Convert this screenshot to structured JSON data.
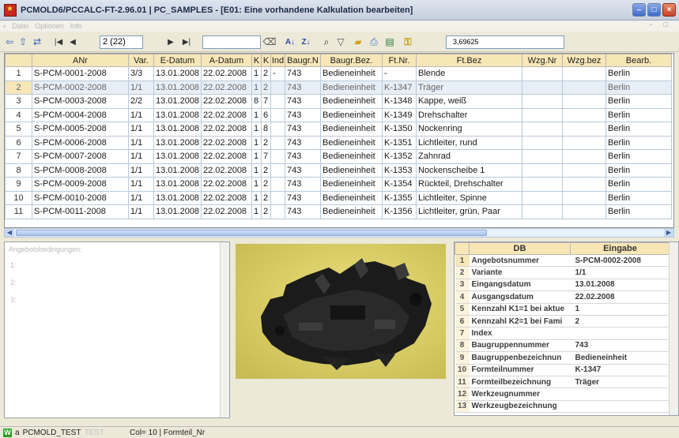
{
  "window": {
    "title": "PCMOLD6/PCCALC-FT-2.96.01  |  PC_SAMPLES - [E01: Eine vorhandene Kalkulation bearbeiten]",
    "minimize": "–",
    "maximize": "□",
    "close": "×"
  },
  "menu": [
    "Datei",
    "Optionen",
    "Info"
  ],
  "mdi_controls": "- □",
  "toolbar": {
    "record_position": "2 (22)",
    "value_field": "3,69625"
  },
  "grid": {
    "columns": [
      "ANr",
      "Var.",
      "E-Datum",
      "A-Datum",
      "K",
      "K",
      "Ind",
      "Baugr.N",
      "Baugr.Bez.",
      "Ft.Nr.",
      "Ft.Bez",
      "Wzg.Nr",
      "Wzg.bez",
      "Bearb."
    ],
    "rows": [
      {
        "n": "1",
        "anr": "S-PCM-0001-2008",
        "var": "3/3",
        "ed": "13.01.2008",
        "ad": "22.02.2008",
        "k1": "1",
        "k2": "2",
        "ind": "-",
        "bgn": "743",
        "bgb": "Bedieneinheit",
        "ftnr": "-",
        "ftbez": "Blende",
        "wnr": "",
        "wbez": "",
        "bearb": "Berlin"
      },
      {
        "n": "2",
        "anr": "S-PCM-0002-2008",
        "var": "1/1",
        "ed": "13.01.2008",
        "ad": "22.02.2008",
        "k1": "1",
        "k2": "2",
        "ind": "",
        "bgn": "743",
        "bgb": "Bedieneinheit",
        "ftnr": "K-1347",
        "ftbez": "Träger",
        "wnr": "",
        "wbez": "",
        "bearb": "Berlin"
      },
      {
        "n": "3",
        "anr": "S-PCM-0003-2008",
        "var": "2/2",
        "ed": "13.01.2008",
        "ad": "22.02.2008",
        "k1": "8",
        "k2": "7",
        "ind": "",
        "bgn": "743",
        "bgb": "Bedieneinheit",
        "ftnr": "K-1348",
        "ftbez": "Kappe, weiß",
        "wnr": "",
        "wbez": "",
        "bearb": "Berlin"
      },
      {
        "n": "4",
        "anr": "S-PCM-0004-2008",
        "var": "1/1",
        "ed": "13.01.2008",
        "ad": "22.02.2008",
        "k1": "1",
        "k2": "6",
        "ind": "",
        "bgn": "743",
        "bgb": "Bedieneinheit",
        "ftnr": "K-1349",
        "ftbez": "Drehschalter",
        "wnr": "",
        "wbez": "",
        "bearb": "Berlin"
      },
      {
        "n": "5",
        "anr": "S-PCM-0005-2008",
        "var": "1/1",
        "ed": "13.01.2008",
        "ad": "22.02.2008",
        "k1": "1",
        "k2": "8",
        "ind": "",
        "bgn": "743",
        "bgb": "Bedieneinheit",
        "ftnr": "K-1350",
        "ftbez": "Nockenring",
        "wnr": "",
        "wbez": "",
        "bearb": "Berlin"
      },
      {
        "n": "6",
        "anr": "S-PCM-0006-2008",
        "var": "1/1",
        "ed": "13.01.2008",
        "ad": "22.02.2008",
        "k1": "1",
        "k2": "2",
        "ind": "",
        "bgn": "743",
        "bgb": "Bedieneinheit",
        "ftnr": "K-1351",
        "ftbez": "Lichtleiter, rund",
        "wnr": "",
        "wbez": "",
        "bearb": "Berlin"
      },
      {
        "n": "7",
        "anr": "S-PCM-0007-2008",
        "var": "1/1",
        "ed": "13.01.2008",
        "ad": "22.02.2008",
        "k1": "1",
        "k2": "7",
        "ind": "",
        "bgn": "743",
        "bgb": "Bedieneinheit",
        "ftnr": "K-1352",
        "ftbez": "Zahnrad",
        "wnr": "",
        "wbez": "",
        "bearb": "Berlin"
      },
      {
        "n": "8",
        "anr": "S-PCM-0008-2008",
        "var": "1/1",
        "ed": "13.01.2008",
        "ad": "22.02.2008",
        "k1": "1",
        "k2": "2",
        "ind": "",
        "bgn": "743",
        "bgb": "Bedieneinheit",
        "ftnr": "K-1353",
        "ftbez": "Nockenscheibe 1",
        "wnr": "",
        "wbez": "",
        "bearb": "Berlin"
      },
      {
        "n": "9",
        "anr": "S-PCM-0009-2008",
        "var": "1/1",
        "ed": "13.01.2008",
        "ad": "22.02.2008",
        "k1": "1",
        "k2": "2",
        "ind": "",
        "bgn": "743",
        "bgb": "Bedieneinheit",
        "ftnr": "K-1354",
        "ftbez": "Rückteil, Drehschalter",
        "wnr": "",
        "wbez": "",
        "bearb": "Berlin"
      },
      {
        "n": "10",
        "anr": "S-PCM-0010-2008",
        "var": "1/1",
        "ed": "13.01.2008",
        "ad": "22.02.2008",
        "k1": "1",
        "k2": "2",
        "ind": "",
        "bgn": "743",
        "bgb": "Bedieneinheit",
        "ftnr": "K-1355",
        "ftbez": "Lichtleiter, Spinne",
        "wnr": "",
        "wbez": "",
        "bearb": "Berlin"
      },
      {
        "n": "11",
        "anr": "S-PCM-0011-2008",
        "var": "1/1",
        "ed": "13.01.2008",
        "ad": "22.02.2008",
        "k1": "1",
        "k2": "2",
        "ind": "",
        "bgn": "743",
        "bgb": "Bedieneinheit",
        "ftnr": "K-1356",
        "ftbez": "Lichtleiter, grün, Paar",
        "wnr": "",
        "wbez": "",
        "bearb": "Berlin"
      }
    ],
    "selected_row": 2
  },
  "notes": {
    "label": "Angebotsbedingungen:",
    "lines": [
      "1:",
      "2:",
      "3:"
    ]
  },
  "db_panel": {
    "headers": [
      "DB",
      "Eingabe"
    ],
    "rows": [
      {
        "n": "1",
        "db": "Angebotsnummer",
        "val": "S-PCM-0002-2008"
      },
      {
        "n": "2",
        "db": "Variante",
        "val": "1/1"
      },
      {
        "n": "3",
        "db": "Eingangsdatum",
        "val": "13.01.2008"
      },
      {
        "n": "4",
        "db": "Ausgangsdatum",
        "val": "22.02.2008"
      },
      {
        "n": "5",
        "db": "Kennzahl K1=1 bei aktue",
        "val": "1"
      },
      {
        "n": "6",
        "db": "Kennzahl K2=1 bei Fami",
        "val": "2"
      },
      {
        "n": "7",
        "db": "Index",
        "val": ""
      },
      {
        "n": "8",
        "db": "Baugruppennummer",
        "val": "743"
      },
      {
        "n": "9",
        "db": "Baugruppenbezeichnun",
        "val": "Bedieneinheit"
      },
      {
        "n": "10",
        "db": "Formteilnummer",
        "val": "K-1347"
      },
      {
        "n": "11",
        "db": "Formteilbezeichnung",
        "val": "Träger"
      },
      {
        "n": "12",
        "db": "Werkzeugnummer",
        "val": ""
      },
      {
        "n": "13",
        "db": "Werkzeugbezeichnung",
        "val": ""
      }
    ]
  },
  "status": {
    "badge": "W",
    "mode": "a",
    "db": "PCMOLD_TEST",
    "test": "TEST",
    "position": "Col= 10 | Formteil_Nr"
  },
  "colors": {
    "header_bg": "#f7e6b6",
    "selected_row": "#e8eef6",
    "image_bg": "#e2d772",
    "part_color": "#1c1c1c"
  }
}
